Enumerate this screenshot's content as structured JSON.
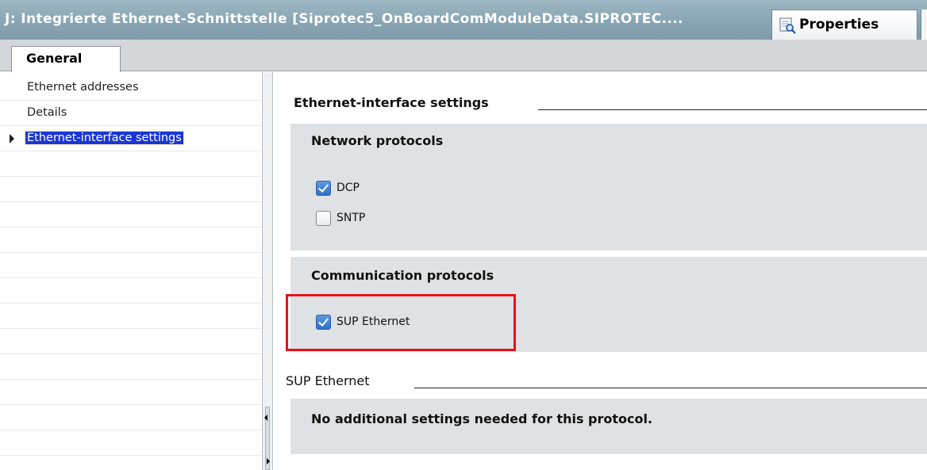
{
  "titlebar": {
    "title": "J: Integrierte Ethernet-Schnittstelle [Siprotec5_OnBoardComModuleData.SIPROTEC....",
    "properties_tab": "Properties"
  },
  "tabs": [
    {
      "label": "General",
      "selected": true
    }
  ],
  "nav": {
    "items": [
      {
        "label": "Ethernet addresses",
        "selected": false
      },
      {
        "label": "Details",
        "selected": false
      },
      {
        "label": "Ethernet-interface settings",
        "selected": true
      }
    ]
  },
  "main": {
    "section_title": "Ethernet-interface settings",
    "network_protocols": {
      "title": "Network protocols",
      "options": [
        {
          "label": "DCP",
          "checked": true
        },
        {
          "label": "SNTP",
          "checked": false
        }
      ]
    },
    "communication_protocols": {
      "title": "Communication protocols",
      "options": [
        {
          "label": "SUP Ethernet",
          "checked": true
        }
      ]
    },
    "sup_section": {
      "title": "SUP Ethernet",
      "message": "No additional settings needed for this protocol."
    }
  },
  "colors": {
    "highlight": "#e8101a",
    "selection": "#1a36d6",
    "checkbox_checked": "#2f6fc9",
    "group_background": "#dfe2e4"
  }
}
